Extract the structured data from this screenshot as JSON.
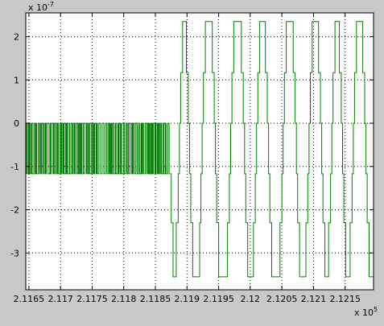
{
  "chart_data": {
    "type": "line",
    "x_multiplier_label": "x 10",
    "x_multiplier_exponent": "5",
    "y_multiplier_label": "x 10",
    "y_multiplier_exponent": "-7",
    "xlim": [
      2.11645,
      2.12195
    ],
    "ylim": [
      -3.85,
      2.55
    ],
    "x_ticks": [
      2.1165,
      2.117,
      2.1175,
      2.118,
      2.1185,
      2.119,
      2.1195,
      2.12,
      2.1205,
      2.121,
      2.1215
    ],
    "x_tick_labels": [
      "2.1165",
      "2.117",
      "2.1175",
      "2.118",
      "2.1185",
      "2.119",
      "2.1195",
      "2.12",
      "2.1205",
      "2.121",
      "2.1215"
    ],
    "y_ticks": [
      -3,
      -2,
      -1,
      0,
      1,
      2
    ],
    "y_tick_labels": [
      "-3",
      "-2",
      "-1",
      "0",
      "1",
      "2"
    ],
    "grid": true,
    "series": [
      {
        "color": "#008000",
        "segments": [
          {
            "kind": "square-burst",
            "x_start": 2.11646,
            "x_end": 2.11873,
            "y_high": 0,
            "y_low": -1.17
          },
          {
            "kind": "staircase",
            "points": [
              [
                2.11873,
                -1.17
              ],
              [
                2.11875,
                -1.17
              ],
              [
                2.11875,
                -2.3
              ],
              [
                2.11878,
                -2.3
              ],
              [
                2.11878,
                -3.55
              ],
              [
                2.11883,
                -3.55
              ],
              [
                2.11883,
                -2.3
              ],
              [
                2.11886,
                -2.3
              ],
              [
                2.11886,
                -1.17
              ],
              [
                2.11888,
                -1.17
              ],
              [
                2.11888,
                0
              ],
              [
                2.1189,
                0
              ],
              [
                2.1189,
                1.17
              ],
              [
                2.11893,
                1.17
              ],
              [
                2.11893,
                2.35
              ],
              [
                2.11899,
                2.35
              ],
              [
                2.11899,
                1.17
              ],
              [
                2.11902,
                1.17
              ],
              [
                2.11902,
                0
              ],
              [
                2.11904,
                0
              ],
              [
                2.11904,
                -1.17
              ],
              [
                2.11906,
                -1.17
              ],
              [
                2.11906,
                -2.3
              ],
              [
                2.11909,
                -2.3
              ],
              [
                2.11909,
                -3.55
              ],
              [
                2.1192,
                -3.55
              ],
              [
                2.1192,
                -2.3
              ],
              [
                2.11922,
                -2.3
              ],
              [
                2.11922,
                -1.17
              ],
              [
                2.11924,
                -1.17
              ],
              [
                2.11924,
                0
              ],
              [
                2.11926,
                0
              ],
              [
                2.11926,
                1.17
              ],
              [
                2.11929,
                1.17
              ],
              [
                2.11929,
                2.35
              ],
              [
                2.1194,
                2.35
              ],
              [
                2.1194,
                1.17
              ],
              [
                2.11943,
                1.17
              ],
              [
                2.11943,
                0
              ],
              [
                2.11945,
                0
              ],
              [
                2.11945,
                -1.17
              ],
              [
                2.11947,
                -1.17
              ],
              [
                2.11947,
                -2.3
              ],
              [
                2.1195,
                -2.3
              ],
              [
                2.1195,
                -3.55
              ],
              [
                2.11964,
                -3.55
              ],
              [
                2.11964,
                -2.3
              ],
              [
                2.11967,
                -2.3
              ],
              [
                2.11967,
                -1.17
              ],
              [
                2.11969,
                -1.17
              ],
              [
                2.11969,
                0
              ],
              [
                2.11971,
                0
              ],
              [
                2.11971,
                1.17
              ],
              [
                2.11974,
                1.17
              ],
              [
                2.11974,
                2.35
              ],
              [
                2.11986,
                2.35
              ],
              [
                2.11986,
                1.17
              ],
              [
                2.11989,
                1.17
              ],
              [
                2.11989,
                0
              ],
              [
                2.11991,
                0
              ],
              [
                2.11991,
                -1.17
              ],
              [
                2.11993,
                -1.17
              ],
              [
                2.11993,
                -2.3
              ],
              [
                2.11996,
                -2.3
              ],
              [
                2.11996,
                -3.55
              ],
              [
                2.12005,
                -3.55
              ],
              [
                2.12005,
                -2.3
              ],
              [
                2.12008,
                -2.3
              ],
              [
                2.12008,
                -1.17
              ],
              [
                2.1201,
                -1.17
              ],
              [
                2.1201,
                0
              ],
              [
                2.12012,
                0
              ],
              [
                2.12012,
                1.17
              ],
              [
                2.12015,
                1.17
              ],
              [
                2.12015,
                2.35
              ],
              [
                2.12024,
                2.35
              ],
              [
                2.12024,
                1.17
              ],
              [
                2.12027,
                1.17
              ],
              [
                2.12027,
                0
              ],
              [
                2.12029,
                0
              ],
              [
                2.12029,
                -1.17
              ],
              [
                2.12031,
                -1.17
              ],
              [
                2.12031,
                -2.3
              ],
              [
                2.12034,
                -2.3
              ],
              [
                2.12034,
                -3.55
              ],
              [
                2.12047,
                -3.55
              ],
              [
                2.12047,
                -2.3
              ],
              [
                2.1205,
                -2.3
              ],
              [
                2.1205,
                -1.17
              ],
              [
                2.12052,
                -1.17
              ],
              [
                2.12052,
                0
              ],
              [
                2.12054,
                0
              ],
              [
                2.12054,
                1.17
              ],
              [
                2.12057,
                1.17
              ],
              [
                2.12057,
                2.35
              ],
              [
                2.12068,
                2.35
              ],
              [
                2.12068,
                1.17
              ],
              [
                2.12071,
                1.17
              ],
              [
                2.12071,
                0
              ],
              [
                2.12073,
                0
              ],
              [
                2.12073,
                -1.17
              ],
              [
                2.12075,
                -1.17
              ],
              [
                2.12075,
                -2.3
              ],
              [
                2.12078,
                -2.3
              ],
              [
                2.12078,
                -3.55
              ],
              [
                2.12088,
                -3.55
              ],
              [
                2.12088,
                -2.3
              ],
              [
                2.12091,
                -2.3
              ],
              [
                2.12091,
                -1.17
              ],
              [
                2.12093,
                -1.17
              ],
              [
                2.12093,
                0
              ],
              [
                2.12095,
                0
              ],
              [
                2.12095,
                1.17
              ],
              [
                2.12098,
                1.17
              ],
              [
                2.12098,
                2.35
              ],
              [
                2.12108,
                2.35
              ],
              [
                2.12108,
                1.17
              ],
              [
                2.12111,
                1.17
              ],
              [
                2.12111,
                0
              ],
              [
                2.12113,
                0
              ],
              [
                2.12113,
                -1.17
              ],
              [
                2.12115,
                -1.17
              ],
              [
                2.12115,
                -2.3
              ],
              [
                2.12118,
                -2.3
              ],
              [
                2.12118,
                -3.55
              ],
              [
                2.12124,
                -3.55
              ],
              [
                2.12124,
                -2.3
              ],
              [
                2.12127,
                -2.3
              ],
              [
                2.12127,
                -1.17
              ],
              [
                2.12129,
                -1.17
              ],
              [
                2.12129,
                0
              ],
              [
                2.12131,
                0
              ],
              [
                2.12131,
                1.17
              ],
              [
                2.12134,
                1.17
              ],
              [
                2.12134,
                2.35
              ],
              [
                2.12141,
                2.35
              ],
              [
                2.12141,
                1.17
              ],
              [
                2.12144,
                1.17
              ],
              [
                2.12144,
                0
              ],
              [
                2.12146,
                0
              ],
              [
                2.12146,
                -1.17
              ],
              [
                2.12148,
                -1.17
              ],
              [
                2.12148,
                -2.3
              ],
              [
                2.12151,
                -2.3
              ],
              [
                2.12151,
                -3.55
              ],
              [
                2.12158,
                -3.55
              ],
              [
                2.12158,
                -2.3
              ],
              [
                2.12161,
                -2.3
              ],
              [
                2.12161,
                -1.17
              ],
              [
                2.12163,
                -1.17
              ],
              [
                2.12163,
                0
              ],
              [
                2.12165,
                0
              ],
              [
                2.12165,
                1.17
              ],
              [
                2.12168,
                1.17
              ],
              [
                2.12168,
                2.35
              ],
              [
                2.12178,
                2.35
              ],
              [
                2.12178,
                1.17
              ],
              [
                2.12181,
                1.17
              ],
              [
                2.12181,
                0
              ],
              [
                2.12183,
                0
              ],
              [
                2.12183,
                -1.17
              ],
              [
                2.12185,
                -1.17
              ],
              [
                2.12185,
                -2.3
              ],
              [
                2.12188,
                -2.3
              ],
              [
                2.12188,
                -3.55
              ],
              [
                2.12195,
                -3.55
              ]
            ]
          }
        ]
      }
    ]
  }
}
